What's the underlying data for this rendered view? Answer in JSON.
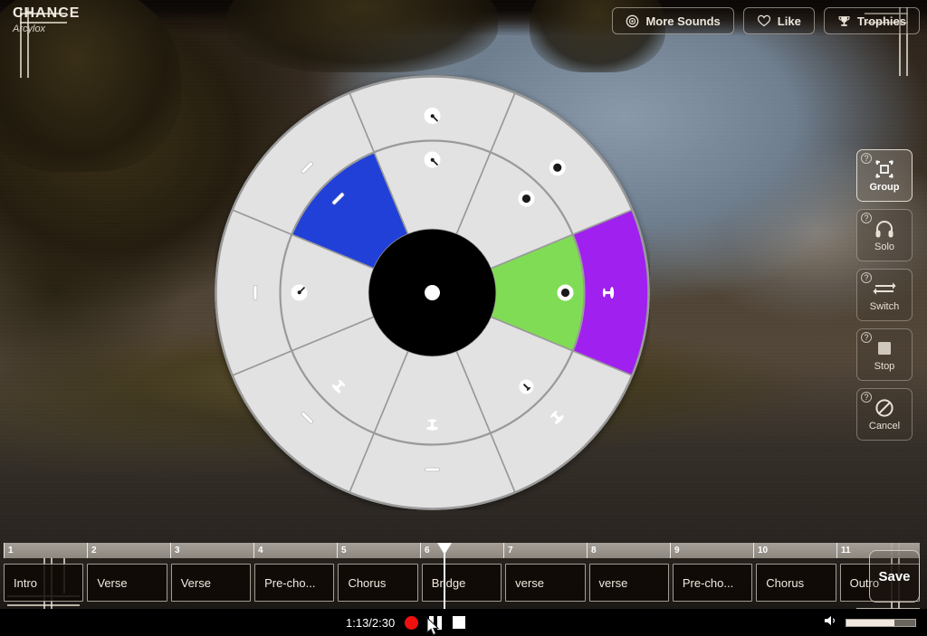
{
  "header": {
    "song_title": "CHANCE",
    "artist": "Arcylox",
    "buttons": [
      {
        "label": "More Sounds",
        "icon": "disc-icon"
      },
      {
        "label": "Like",
        "icon": "heart-icon"
      },
      {
        "label": "Trophies",
        "icon": "trophy-icon"
      }
    ]
  },
  "tools": {
    "help_badge": "?",
    "items": [
      {
        "label": "Group",
        "icon": "group-select-icon",
        "active": true
      },
      {
        "label": "Solo",
        "icon": "headphones-icon",
        "active": false
      },
      {
        "label": "Switch",
        "icon": "swap-arrows-icon",
        "active": false
      },
      {
        "label": "Stop",
        "icon": "stop-square-icon",
        "active": false
      },
      {
        "label": "Cancel",
        "icon": "no-entry-icon",
        "active": false
      }
    ]
  },
  "wheel": {
    "hub_color": "#000000",
    "hub_dot_color": "#ffffff",
    "segment_base_color": "#e2e2e2",
    "divider_color": "#9a9a9a",
    "inner_segments": [
      {
        "index": 0,
        "color": "#e2e2e2",
        "icon": "drumstick-icon"
      },
      {
        "index": 1,
        "color": "#e2e2e2",
        "icon": "dot-icon"
      },
      {
        "index": 2,
        "color": "#80dc55",
        "icon": "dot-icon"
      },
      {
        "index": 3,
        "color": "#e2e2e2",
        "icon": "hihat-icon"
      },
      {
        "index": 4,
        "color": "#e2e2e2",
        "icon": "cymbal-icon"
      },
      {
        "index": 5,
        "color": "#e2e2e2",
        "icon": "cymbal-icon"
      },
      {
        "index": 6,
        "color": "#e2e2e2",
        "icon": "drumstick-icon"
      },
      {
        "index": 7,
        "color": "#2040d8",
        "icon": "stick-icon"
      }
    ],
    "outer_segments": [
      {
        "index": 0,
        "color": "#e2e2e2",
        "icon": "drumstick-icon"
      },
      {
        "index": 1,
        "color": "#e2e2e2",
        "icon": "dot-icon"
      },
      {
        "index": 2,
        "color": "#a020f0",
        "icon": "cymbal-icon"
      },
      {
        "index": 3,
        "color": "#e2e2e2",
        "icon": "cymbal-icon"
      },
      {
        "index": 4,
        "color": "#e2e2e2",
        "icon": "stick-icon"
      },
      {
        "index": 5,
        "color": "#e2e2e2",
        "icon": "stick-icon"
      },
      {
        "index": 6,
        "color": "#e2e2e2",
        "icon": "stick-icon"
      },
      {
        "index": 7,
        "color": "#e2e2e2",
        "icon": "stick-icon"
      }
    ]
  },
  "timeline": {
    "ruler_marks": [
      "1",
      "2",
      "3",
      "4",
      "5",
      "6",
      "7",
      "8",
      "9",
      "10",
      "11"
    ],
    "playhead_bar": "6",
    "segments": [
      {
        "label": "Intro"
      },
      {
        "label": "Verse"
      },
      {
        "label": "Verse"
      },
      {
        "label": "Pre-cho..."
      },
      {
        "label": "Chorus"
      },
      {
        "label": "Bridge"
      },
      {
        "label": "verse"
      },
      {
        "label": "verse"
      },
      {
        "label": "Pre-cho..."
      },
      {
        "label": "Chorus"
      },
      {
        "label": "Outro"
      }
    ],
    "save_label": "Save"
  },
  "transport": {
    "time_code": "1:13/2:30",
    "record_label": "Record",
    "pause_label": "Pause",
    "stop_label": "Stop",
    "volume_icon": "speaker-icon",
    "volume_percent": 70
  }
}
